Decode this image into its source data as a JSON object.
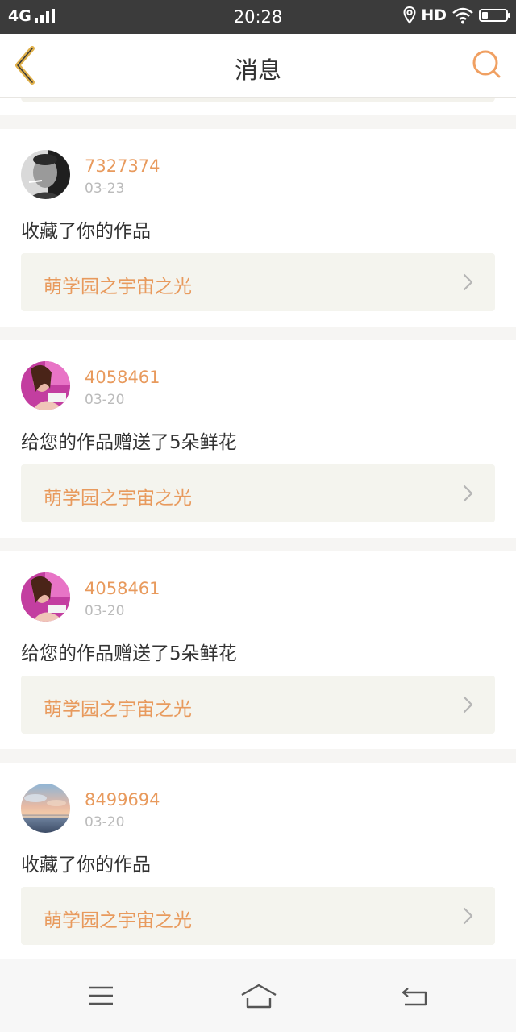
{
  "status_bar": {
    "network": "4G",
    "time": "20:28",
    "hd": "HD",
    "battery_level": 0.25
  },
  "header": {
    "title": "消息"
  },
  "messages": [
    {
      "username": "7327374",
      "date": "03-23",
      "action": "收藏了你的作品",
      "work_title": "萌学园之宇宙之光",
      "avatar": "bw-portrait"
    },
    {
      "username": "4058461",
      "date": "03-20",
      "action": "给您的作品赠送了5朵鲜花",
      "work_title": "萌学园之宇宙之光",
      "avatar": "pink-portrait"
    },
    {
      "username": "4058461",
      "date": "03-20",
      "action": "给您的作品赠送了5朵鲜花",
      "work_title": "萌学园之宇宙之光",
      "avatar": "pink-portrait"
    },
    {
      "username": "8499694",
      "date": "03-20",
      "action": "收藏了你的作品",
      "work_title": "萌学园之宇宙之光",
      "avatar": "sunset-landscape"
    }
  ],
  "colors": {
    "accent": "#e89a5d",
    "back_icon": "#e0b04a",
    "card_bg": "#ffffff",
    "work_bg": "#f4f4ee"
  },
  "icons": {
    "back": "chevron-left-icon",
    "search": "search-icon",
    "arrow": "chevron-right-icon",
    "menu": "menu-icon",
    "home": "home-icon",
    "return": "return-icon"
  }
}
